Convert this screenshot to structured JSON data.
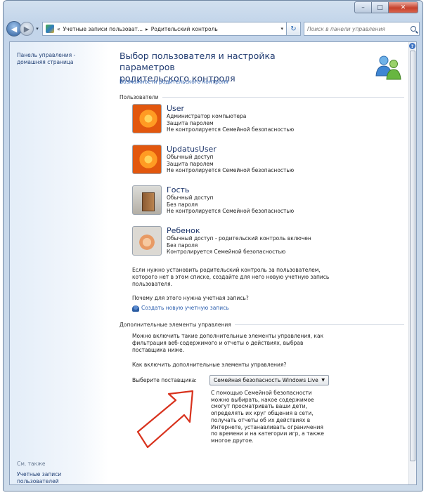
{
  "window": {
    "minimize_glyph": "–",
    "maximize_glyph": "□",
    "close_glyph": "✕"
  },
  "nav": {
    "back_glyph": "◀",
    "forward_glyph": "▶",
    "history_glyph": "▾",
    "breadcrumb": [
      "«",
      "Учетные записи пользоват...",
      "▸",
      "Родительский контроль"
    ],
    "address_dropdown": "▾",
    "refresh_glyph": "↻",
    "search_placeholder": "Поиск в панели управления"
  },
  "sidebar": {
    "home_link_line1": "Панель управления -",
    "home_link_line2": "домашняя страница",
    "see_also": "См. также",
    "accounts_link_line1": "Учетные записи",
    "accounts_link_line2": "пользователей"
  },
  "main": {
    "title_line1": "Выбор пользователя и настройка параметров",
    "title_line2": "родительского контроля",
    "features_link": "Возможности родительского контроля",
    "users_heading": "Пользователи",
    "users": [
      {
        "name": "User",
        "lines": [
          "Администратор компьютера",
          "Защита паролем",
          "Не контролируется Семейной безопасностью"
        ]
      },
      {
        "name": "UpdatusUser",
        "lines": [
          "Обычный доступ",
          "Защита паролем",
          "Не контролируется Семейной безопасностью"
        ]
      },
      {
        "name": "Гость",
        "lines": [
          "Обычный доступ",
          "Без пароля",
          "Не контролируется Семейной безопасностью"
        ]
      },
      {
        "name": "Ребенок",
        "lines": [
          "Обычный доступ - родительский контроль включен",
          "Без пароля",
          "Контролируется Семейной безопасностью"
        ]
      }
    ],
    "not_listed_text": [
      "Если нужно установить родительский контроль за пользователем,",
      "которого нет в этом списке, создайте для него новую учетную запись",
      "пользователя."
    ],
    "why_link": "Почему для этого нужна учетная запись?",
    "create_link": "Создать новую учетную запись",
    "extra_heading": "Дополнительные элементы управления",
    "extra_text": [
      "Можно включить такие дополнительные элементы управления, как",
      "фильтрация веб-содержимого и отчеты о действиях, выбрав",
      "поставщика ниже."
    ],
    "extra_link": "Как включить дополнительные элементы управления?",
    "provider_label": "Выберите поставщика:",
    "provider_value": "Семейная безопасность Windows Live",
    "provider_caret": "▼",
    "provider_desc": [
      "С помощью Семейной безопасности",
      "можно выбирать, какое содержимое",
      "смогут просматривать ваши дети,",
      "определять их круг общения в сети,",
      "получать отчеты об их действиях в",
      "Интернете, устанавливать ограничения",
      "по времени и на категории игр, а также",
      "многое другое."
    ]
  },
  "help_glyph": "?",
  "colors": {
    "link": "#2c5fae",
    "title": "#1f3a70",
    "arrow": "#d8321d"
  }
}
